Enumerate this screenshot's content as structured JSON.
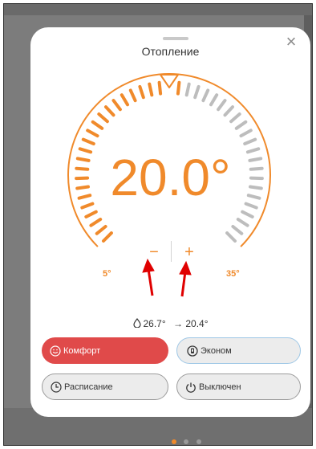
{
  "modal": {
    "title": "Отопление",
    "close_glyph": "×",
    "close_icon": "close-icon"
  },
  "thermostat": {
    "setpoint_text": "20.0°",
    "setpoint_value": 20.0,
    "min_label": "5°",
    "max_label": "35°",
    "min": 5,
    "max": 35,
    "minus_label": "−",
    "plus_label": "+",
    "current_temperature": "26.7°",
    "arrow_symbol": "→",
    "target_temperature": "20.4°",
    "accent_color": "#f08a2b",
    "tick_color_inactive": "#bdbdbd"
  },
  "modes": {
    "comfort": {
      "label": "Комфорт",
      "icon": "smile-icon",
      "active": true,
      "color": "#e04a4a"
    },
    "economy": {
      "label": "Эконом",
      "icon": "economy-icon",
      "active": false
    },
    "schedule": {
      "label": "Расписание",
      "icon": "clock-icon",
      "active": false
    },
    "off": {
      "label": "Выключен",
      "icon": "power-icon",
      "active": false
    }
  },
  "annotation_arrows": {
    "color": "#e00000",
    "count": 2
  },
  "pager": {
    "count": 3,
    "active_index": 0,
    "active_color": "#f08a2b"
  }
}
